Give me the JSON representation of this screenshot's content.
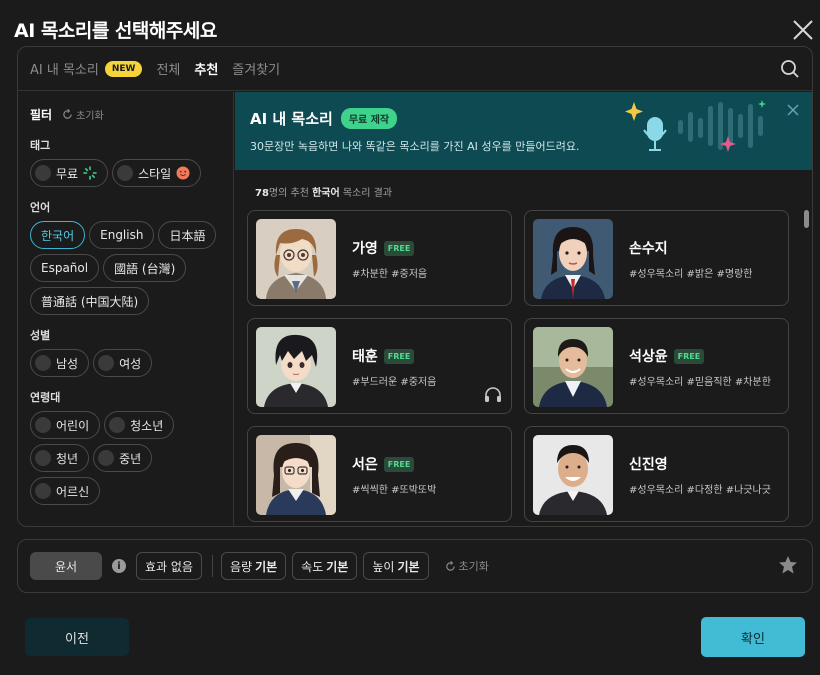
{
  "dialog": {
    "title": "AI 목소리를 선택해주세요"
  },
  "tabs": [
    {
      "label": "AI 내 목소리",
      "badge": "NEW"
    },
    {
      "label": "전체"
    },
    {
      "label": "추천"
    },
    {
      "label": "즐겨찾기"
    }
  ],
  "filter": {
    "title": "필터",
    "reset_label": "초기화",
    "groups": [
      {
        "label": "태그",
        "options": [
          "무료",
          "스타일"
        ]
      },
      {
        "label": "언어",
        "options": [
          "한국어",
          "English",
          "日本語",
          "Español",
          "國語 (台灣)",
          "普通話 (中国大陆)"
        ],
        "selected": "한국어"
      },
      {
        "label": "성별",
        "options": [
          "남성",
          "여성"
        ]
      },
      {
        "label": "연령대",
        "options": [
          "어린이",
          "청소년",
          "청년",
          "중년",
          "어르신"
        ]
      }
    ]
  },
  "banner": {
    "title": "AI 내 목소리",
    "badge": "무료 제작",
    "description": "30문장만 녹음하면 나와 똑같은 목소리를 가진 AI 성우를 만들어드려요."
  },
  "results": {
    "count": "78",
    "mid": "명의 추천 ",
    "language": "한국어",
    "suffix": " 목소리 결과"
  },
  "voices": [
    {
      "name": "가영",
      "free": "FREE",
      "tags": "#차분한 #중저음",
      "avatar": "anime-girl"
    },
    {
      "name": "손수지",
      "free": "",
      "tags": "#성우목소리 #밝은 #명랑한",
      "avatar": "woman"
    },
    {
      "name": "태훈",
      "free": "FREE",
      "tags": "#부드러운 #중저음",
      "avatar": "anime-boy"
    },
    {
      "name": "석상윤",
      "free": "FREE",
      "tags": "#성우목소리 #믿음직한 #차분한",
      "avatar": "man"
    },
    {
      "name": "서은",
      "free": "FREE",
      "tags": "#씩씩한 #또박또박",
      "avatar": "anime-girl-glasses"
    },
    {
      "name": "신진영",
      "free": "",
      "tags": "#성우목소리 #다정한 #나긋나긋",
      "avatar": "man-smile"
    }
  ],
  "bottom": {
    "voice_label": "윤서",
    "effect_label": "효과 없음",
    "volume": {
      "label": "음량",
      "value": "기본"
    },
    "speed": {
      "label": "속도",
      "value": "기본"
    },
    "pitch": {
      "label": "높이",
      "value": "기본"
    },
    "reset_label": "초기화"
  },
  "actions": {
    "prev": "이전",
    "confirm": "확인"
  },
  "colors": {
    "accent": "#41bcd4",
    "banner_bg": "#0e4a52",
    "free_badge": "#4fdc8f",
    "new_badge": "#f5d33b"
  }
}
